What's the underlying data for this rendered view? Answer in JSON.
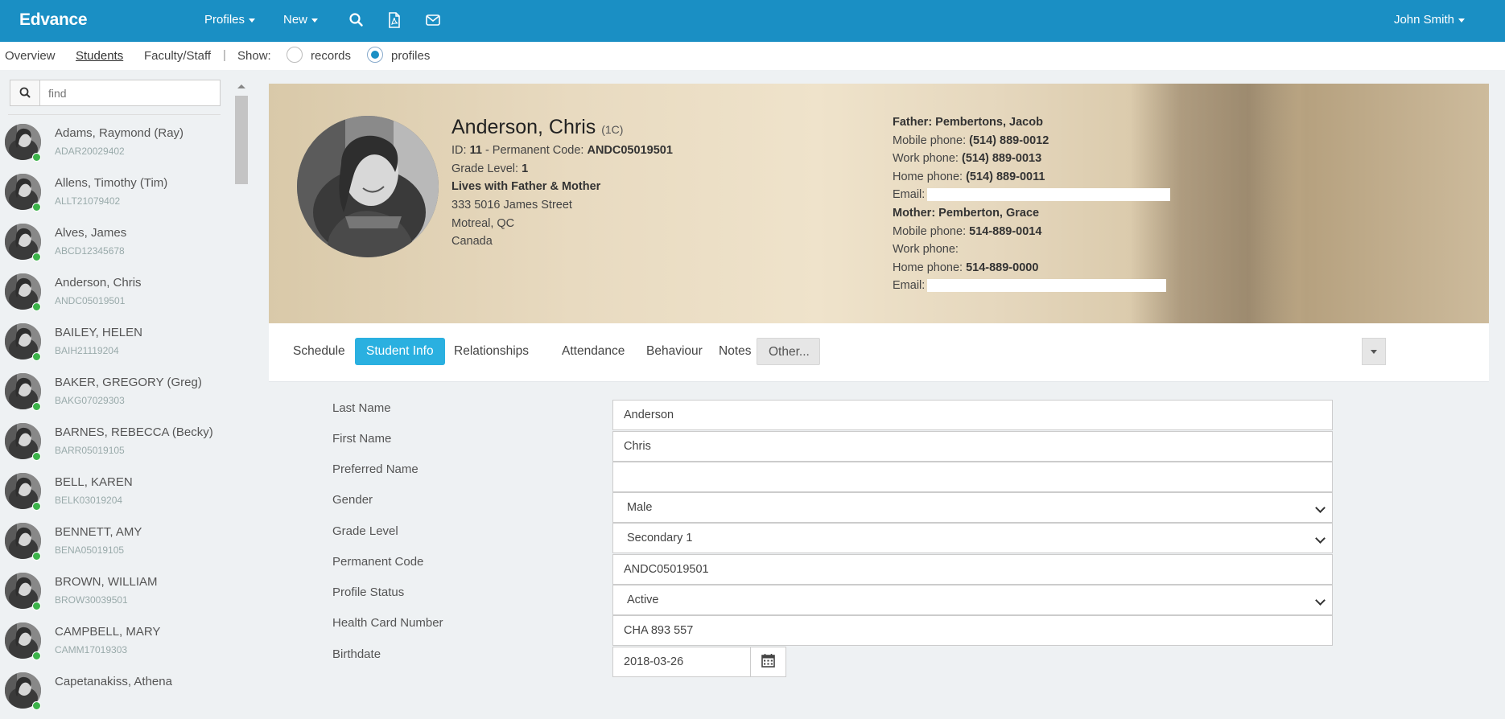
{
  "app": {
    "brand": "Edvance",
    "nav": {
      "profiles": "Profiles",
      "new": "New"
    },
    "user": "John Smith"
  },
  "subnav": {
    "overview": "Overview",
    "students": "Students",
    "faculty": "Faculty/Staff",
    "separator": "|",
    "show_label": "Show:",
    "records": "records",
    "profiles": "profiles",
    "selected": "profiles"
  },
  "search": {
    "placeholder": "find"
  },
  "students": [
    {
      "name": "Adams, Raymond (Ray)",
      "code": "ADAR20029402"
    },
    {
      "name": "Allens, Timothy (Tim)",
      "code": "ALLT21079402"
    },
    {
      "name": "Alves, James",
      "code": "ABCD12345678"
    },
    {
      "name": "Anderson, Chris",
      "code": "ANDC05019501"
    },
    {
      "name": "BAILEY, HELEN",
      "code": "BAIH21119204"
    },
    {
      "name": "BAKER, GREGORY (Greg)",
      "code": "BAKG07029303"
    },
    {
      "name": "BARNES, REBECCA (Becky)",
      "code": "BARR05019105"
    },
    {
      "name": "BELL, KAREN",
      "code": "BELK03019204"
    },
    {
      "name": "BENNETT, AMY",
      "code": "BENA05019105"
    },
    {
      "name": "BROWN, WILLIAM",
      "code": "BROW30039501"
    },
    {
      "name": "CAMPBELL, MARY",
      "code": "CAMM17019303"
    },
    {
      "name": "Capetanakiss, Athena",
      "code": ""
    }
  ],
  "profile": {
    "name": "Anderson, Chris",
    "class": "(1C)",
    "id_label": "ID:",
    "id": "11",
    "perm_label": "- Permanent Code:",
    "perm_code": "ANDC05019501",
    "grade_label": "Grade Level:",
    "grade": "1",
    "lives_with": "Lives with Father & Mother",
    "address1": "333 5016 James Street",
    "address2": "Motreal, QC",
    "country": "Canada",
    "father": {
      "title": "Father: Pembertons, Jacob",
      "mobile_label": "Mobile phone:",
      "mobile": "(514) 889-0012",
      "work_label": "Work phone:",
      "work": "(514) 889-0013",
      "home_label": "Home phone:",
      "home": "(514) 889-0011",
      "email_label": "Email:"
    },
    "mother": {
      "title": "Mother: Pemberton, Grace",
      "mobile_label": "Mobile phone:",
      "mobile": "514-889-0014",
      "work_label": "Work phone:",
      "work": "",
      "home_label": "Home phone:",
      "home": "514-889-0000",
      "email_label": "Email:"
    }
  },
  "tabs": {
    "schedule": "Schedule",
    "student_info": "Student Info",
    "relationships": "Relationships",
    "attendance": "Attendance",
    "behaviour": "Behaviour",
    "notes": "Notes",
    "other": "Other...",
    "active": "Student Info"
  },
  "form": {
    "last_name": {
      "label": "Last Name",
      "value": "Anderson"
    },
    "first_name": {
      "label": "First Name",
      "value": "Chris"
    },
    "preferred_name": {
      "label": "Preferred Name",
      "value": ""
    },
    "gender": {
      "label": "Gender",
      "value": "Male"
    },
    "grade_level": {
      "label": "Grade Level",
      "value": "Secondary 1"
    },
    "permanent_code": {
      "label": "Permanent Code",
      "value": "ANDC05019501"
    },
    "profile_status": {
      "label": "Profile Status",
      "value": "Active"
    },
    "health_card": {
      "label": "Health Card Number",
      "value": "CHA 893 557"
    },
    "birthdate": {
      "label": "Birthdate",
      "value": "2018-03-26"
    }
  },
  "colors": {
    "topbar": "#1a8fc4",
    "accent_tab": "#2ab0e0",
    "online": "#3cb34a"
  }
}
